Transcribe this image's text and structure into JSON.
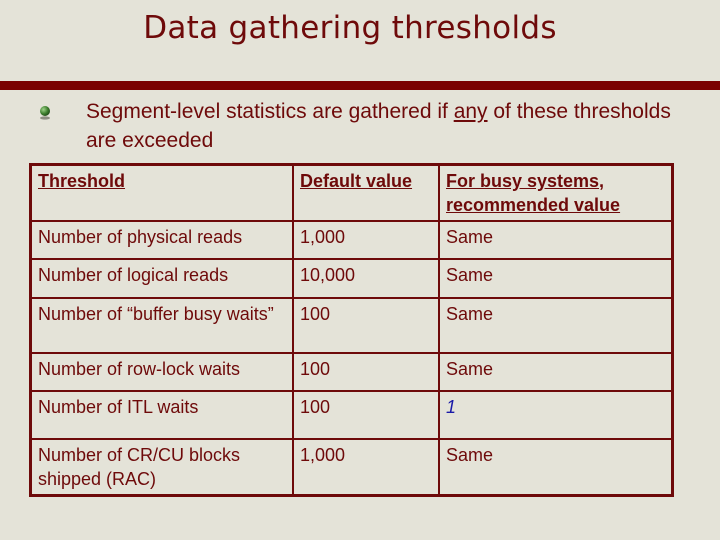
{
  "slide": {
    "title": "Data gathering thresholds",
    "bullet": {
      "icon": "green-globe-bullet-icon",
      "text_before": "Segment-level statistics are gathered if ",
      "text_emphasis": "any",
      "text_after": " of these thresholds are exceeded"
    },
    "table": {
      "headers": [
        "Threshold",
        "Default value",
        "For busy systems, recommended value"
      ],
      "rows": [
        {
          "threshold": "Number of physical reads",
          "default": "1,000",
          "recommended": "Same"
        },
        {
          "threshold": "Number of logical reads",
          "default": "10,000",
          "recommended": "Same"
        },
        {
          "threshold": "Number of “buffer busy waits”",
          "default": "100",
          "recommended": "Same"
        },
        {
          "threshold": "Number of row-lock waits",
          "default": "100",
          "recommended": "Same"
        },
        {
          "threshold": "Number of ITL waits",
          "default": "100",
          "recommended": "1"
        },
        {
          "threshold": "Number of CR/CU blocks shipped (RAC)",
          "default": "1,000",
          "recommended": "Same"
        }
      ]
    },
    "colors": {
      "background": "#e4e3d8",
      "accent": "#7a0000",
      "text": "#6e0a0a",
      "highlight": "#1a1aa8"
    }
  }
}
